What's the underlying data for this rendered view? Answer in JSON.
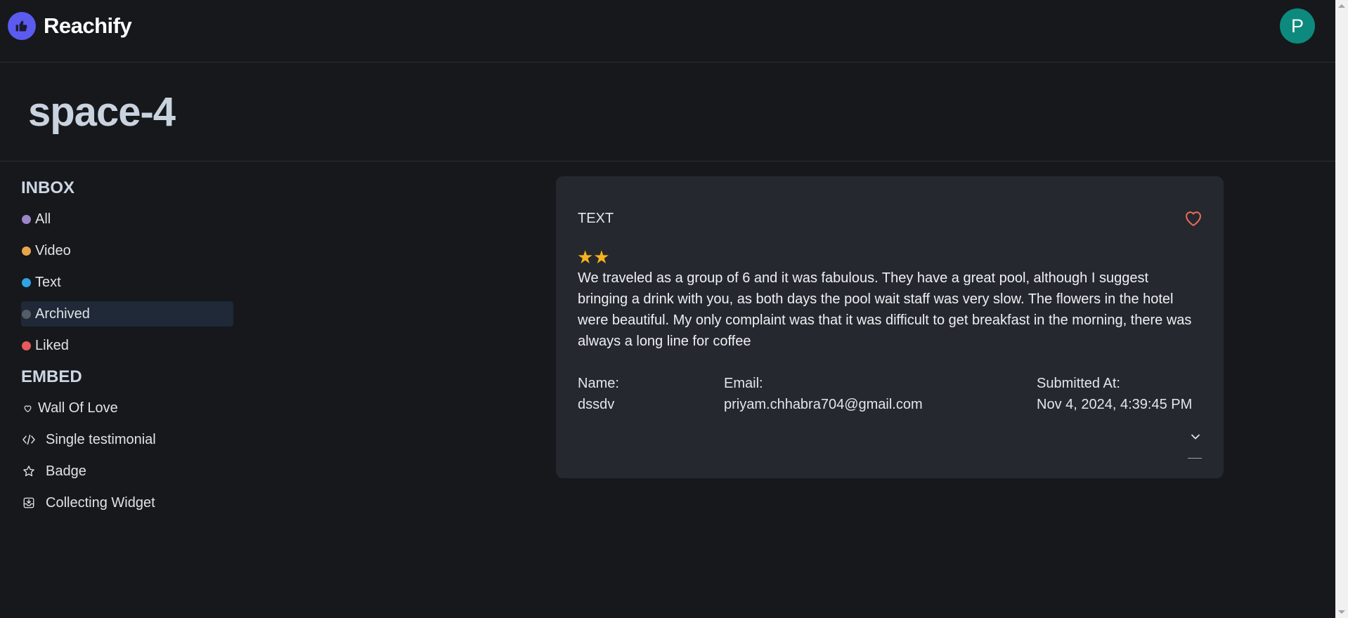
{
  "header": {
    "brand": "Reachify",
    "avatar_initial": "P",
    "logo_icon": "thumbs-up-icon"
  },
  "space": {
    "title": "space-4"
  },
  "sidebar": {
    "inbox_heading": "INBOX",
    "inbox_items": [
      {
        "label": "All",
        "color": "#9b86c9"
      },
      {
        "label": "Video",
        "color": "#e8a64a"
      },
      {
        "label": "Text",
        "color": "#2ea4e6"
      },
      {
        "label": "Archived",
        "color": "#555c66",
        "active": true
      },
      {
        "label": "Liked",
        "color": "#e85a5a"
      }
    ],
    "embed_heading": "EMBED",
    "embed_items": [
      {
        "label": "Wall Of Love",
        "icon": "heart-icon"
      },
      {
        "label": "Single testimonial",
        "icon": "code-icon"
      },
      {
        "label": "Badge",
        "icon": "star-icon"
      },
      {
        "label": "Collecting Widget",
        "icon": "inbox-icon"
      }
    ]
  },
  "testimonial": {
    "type": "TEXT",
    "rating": 2,
    "stars_text": "★★",
    "text": "We traveled as a group of 6 and it was fabulous. They have a great pool, although I suggest bringing a drink with you, as both days the pool wait staff was very slow. The flowers in the hotel were beautiful. My only complaint was that it was difficult to get breakfast in the morning, there was always a long line for coffee",
    "name_label": "Name:",
    "name": "dssdv",
    "email_label": "Email:",
    "email": "priyam.chhabra704@gmail.com",
    "submitted_label": "Submitted At:",
    "submitted_at": "Nov 4, 2024, 4:39:45 PM",
    "accent_color": "#e86a5a",
    "star_color": "#f5b31f"
  }
}
